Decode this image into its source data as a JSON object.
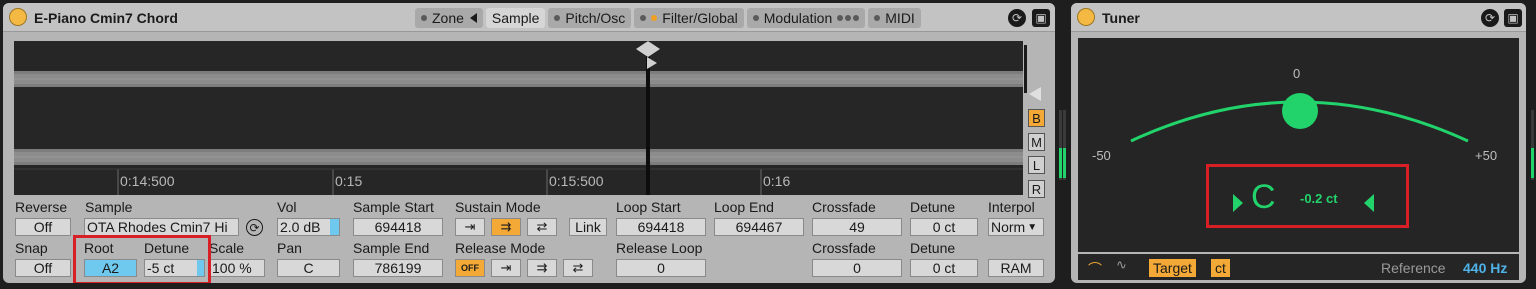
{
  "sampler": {
    "title": "E-Piano Cmin7 Chord",
    "tabs": [
      {
        "label": "Zone",
        "active": false
      },
      {
        "label": "Sample",
        "active": true
      },
      {
        "label": "Pitch/Osc",
        "active": false
      },
      {
        "label": "Filter/Global",
        "active": false
      },
      {
        "label": "Modulation",
        "active": false
      },
      {
        "label": "MIDI",
        "active": false
      }
    ],
    "timeline": [
      "0:14:500",
      "0:15",
      "0:15:500",
      "0:16"
    ],
    "side_buttons": [
      "B",
      "M",
      "L",
      "R"
    ],
    "controls": {
      "reverse_label": "Reverse",
      "reverse_value": "Off",
      "sample_label": "Sample",
      "sample_value": "OTA Rhodes Cmin7 Hi",
      "vol_label": "Vol",
      "vol_value": "2.0 dB",
      "sample_start_label": "Sample Start",
      "sample_start_value": "694418",
      "sustain_mode_label": "Sustain Mode",
      "link_label": "Link",
      "loop_start_label": "Loop Start",
      "loop_start_value": "694418",
      "loop_end_label": "Loop End",
      "loop_end_value": "694467",
      "crossfade_label": "Crossfade",
      "crossfade_value": "49",
      "detune_label": "Detune",
      "detune_value": "0 ct",
      "interpol_label": "Interpol",
      "interpol_value": "Norm",
      "snap_label": "Snap",
      "snap_value": "Off",
      "root_label": "Root",
      "root_value": "A2",
      "detune2_label": "Detune",
      "detune2_value": "-5 ct",
      "scale_label": "Scale",
      "scale_value": "100 %",
      "pan_label": "Pan",
      "pan_value": "C",
      "sample_end_label": "Sample End",
      "sample_end_value": "786199",
      "release_mode_label": "Release Mode",
      "release_off": "OFF",
      "release_loop_label": "Release Loop",
      "release_loop_value": "0",
      "crossfade2_label": "Crossfade",
      "crossfade2_value": "0",
      "detune3_label": "Detune",
      "detune3_value": "0 ct",
      "ram_label": "RAM"
    }
  },
  "tuner": {
    "title": "Tuner",
    "scale_center": "0",
    "scale_min": "-50",
    "scale_max": "+50",
    "note": "C",
    "cents": "-0.2 ct",
    "target_label": "Target",
    "ct_label": "ct",
    "reference_label": "Reference",
    "reference_value": "440 Hz"
  },
  "colors": {
    "accent_orange": "#f4a936",
    "tuner_green": "#22d36b",
    "highlight_red": "#d81f26",
    "root_blue": "#6fc9ee"
  }
}
